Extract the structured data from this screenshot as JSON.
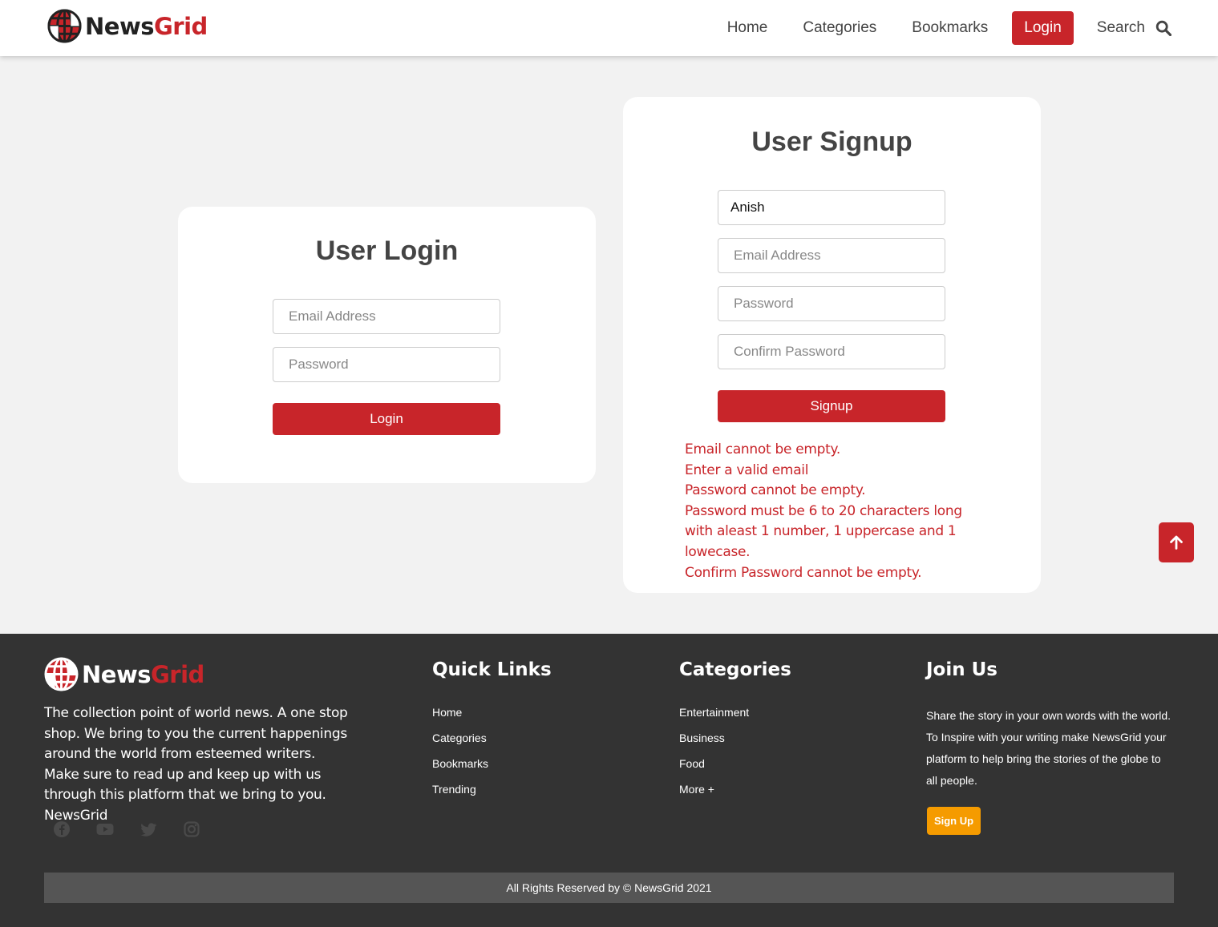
{
  "brand": {
    "name_part1": "News",
    "name_part2": "Grid",
    "accent": "#c8252a"
  },
  "header": {
    "nav": {
      "home": "Home",
      "categories": "Categories",
      "bookmarks": "Bookmarks",
      "login": "Login",
      "search": "Search"
    },
    "search_icon": "search-icon"
  },
  "login": {
    "title": "User Login",
    "email_placeholder": "Email Address",
    "password_placeholder": "Password",
    "button": "Login"
  },
  "signup": {
    "title": "User Signup",
    "name_value": "Anish",
    "email_placeholder": "Email Address",
    "password_placeholder": "Password",
    "confirm_placeholder": "Confirm Password",
    "button": "Signup",
    "errors": [
      "Email cannot be empty.",
      "Enter a valid email",
      "Password cannot be empty.",
      "Password must be 6 to 20 characters long with aleast 1 number, 1 uppercase and 1 lowecase.",
      "Confirm Password cannot be empty."
    ]
  },
  "scroll_top_icon": "arrow-up-icon",
  "footer": {
    "about": "The collection point of world news. A one stop shop. We bring to you the current happenings around the world from esteemed writers. Make sure to read up and keep up with us through this platform that we bring to you. NewsGrid",
    "social_icons": [
      "facebook-icon",
      "youtube-icon",
      "twitter-icon",
      "instagram-icon"
    ],
    "quick_links": {
      "title": "Quick Links",
      "items": [
        "Home",
        "Categories",
        "Bookmarks",
        "Trending"
      ]
    },
    "categories": {
      "title": "Categories",
      "items": [
        "Entertainment",
        "Business",
        "Food",
        "More +"
      ]
    },
    "join": {
      "title": "Join Us",
      "text": "Share the story in your own words with the world. To Inspire with your writing make NewsGrid your platform to help bring the stories of the globe to all people.",
      "button": "Sign Up",
      "button_color": "#f59b00"
    },
    "copyright": "All Rights Reserved by © NewsGrid 2021"
  }
}
